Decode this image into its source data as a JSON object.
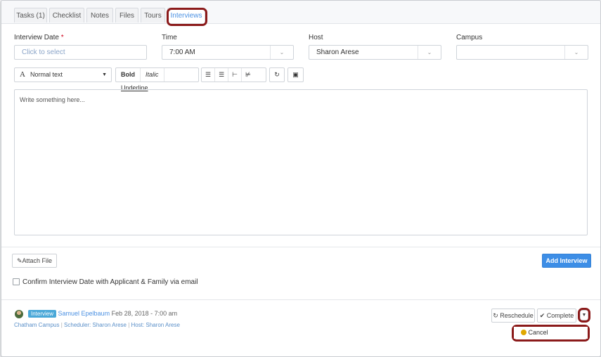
{
  "tabs": [
    {
      "label": "Tasks (1)"
    },
    {
      "label": "Checklist"
    },
    {
      "label": "Notes"
    },
    {
      "label": "Files"
    },
    {
      "label": "Tours"
    },
    {
      "label": "Interviews"
    }
  ],
  "form": {
    "interview_date": {
      "label": "Interview Date",
      "required_mark": "*",
      "placeholder": "Click to select"
    },
    "time": {
      "label": "Time",
      "value": "7:00 AM"
    },
    "host": {
      "label": "Host",
      "value": "Sharon Arese"
    },
    "campus": {
      "label": "Campus",
      "value": ""
    }
  },
  "toolbar": {
    "paragraph_style": "Normal text",
    "bold": "Bold",
    "italic": "Italic",
    "underline": "Underline"
  },
  "editor": {
    "placeholder": "Write something here..."
  },
  "actions": {
    "attach_file": "Attach File",
    "add_interview": "Add Interview",
    "confirm_label": "Confirm Interview Date with Applicant & Family via email"
  },
  "interview": {
    "badge": "Interview",
    "person": "Samuel Epelbaum",
    "datetime": "Feb 28, 2018 - 7:00 am",
    "campus": "Chatham Campus",
    "scheduler": "Scheduler: Sharon Arese",
    "host": "Host: Sharon Arese",
    "separator": "|",
    "reschedule": "Reschedule",
    "complete": "Complete",
    "cancel": "Cancel"
  },
  "colors": {
    "accent": "#4a90e2",
    "primary_button": "#3d8ee6",
    "highlight": "#8b1a1a"
  }
}
